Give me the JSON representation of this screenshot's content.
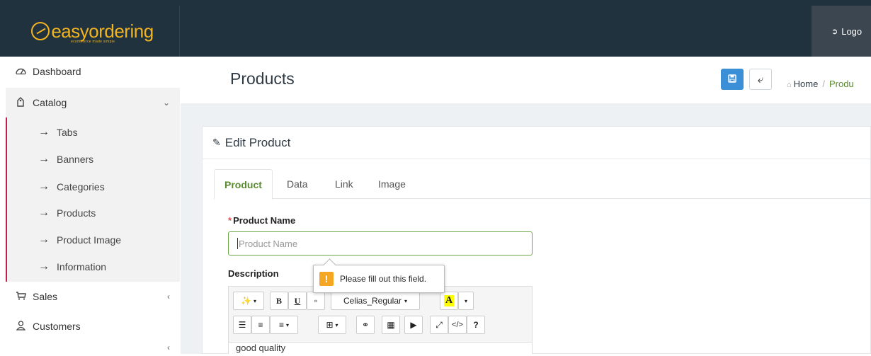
{
  "brand": {
    "name": "easyordering",
    "tagline": "ecommerce made simple"
  },
  "header": {
    "logout_label": "Logo"
  },
  "sidebar": {
    "dashboard": "Dashboard",
    "catalog": "Catalog",
    "catalog_items": [
      {
        "label": "Tabs"
      },
      {
        "label": "Banners"
      },
      {
        "label": "Categories"
      },
      {
        "label": "Products"
      },
      {
        "label": "Product Image"
      },
      {
        "label": "Information"
      }
    ],
    "sales": "Sales",
    "customers": "Customers"
  },
  "page": {
    "title": "Products",
    "breadcrumb": {
      "home": "Home",
      "separator": "/",
      "current": "Produ"
    }
  },
  "card": {
    "title": "Edit Product"
  },
  "tabs": [
    {
      "label": "Product",
      "active": true
    },
    {
      "label": "Data",
      "active": false
    },
    {
      "label": "Link",
      "active": false
    },
    {
      "label": "Image",
      "active": false
    }
  ],
  "form": {
    "product_name_label": "Product Name",
    "required_mark": "*",
    "product_name_placeholder": "Product Name",
    "product_name_value": "",
    "description_label": "Description",
    "validation_message": "Please fill out this field.",
    "description_value": "good quality"
  },
  "editor_toolbar": {
    "bold": "B",
    "underline": "U",
    "font_name": "Celias_Regular",
    "color_letter": "A",
    "help": "?",
    "code": "</>"
  },
  "colors": {
    "topbar": "#1f323e",
    "accent_green": "#5a8b2f",
    "save_button": "#3a8fd6",
    "catalog_marker": "#c0204a",
    "logo": "#f2b321"
  }
}
